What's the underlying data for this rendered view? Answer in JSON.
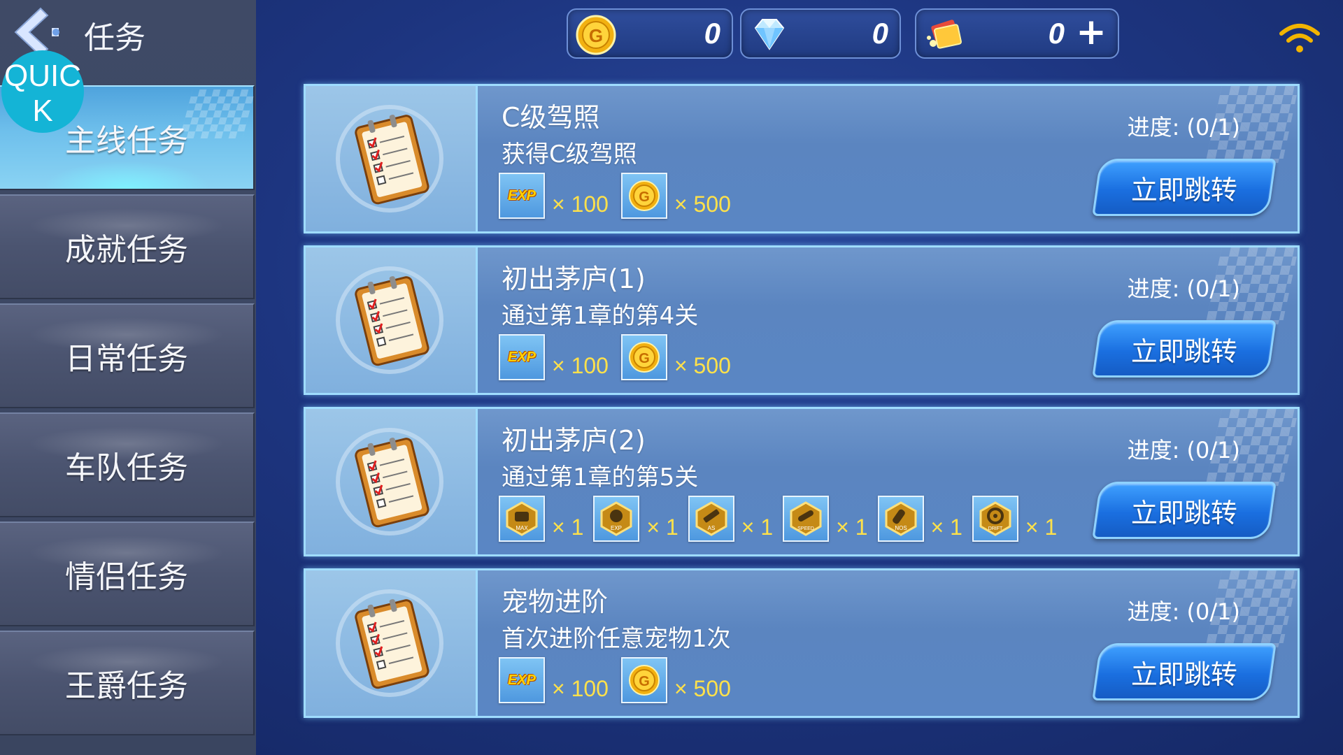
{
  "header": {
    "title": "任务",
    "quick_badge": "QUIC\nK"
  },
  "sidebar": {
    "tabs": [
      {
        "label": "主线任务",
        "active": true
      },
      {
        "label": "成就任务",
        "active": false
      },
      {
        "label": "日常任务",
        "active": false
      },
      {
        "label": "车队任务",
        "active": false
      },
      {
        "label": "情侣任务",
        "active": false
      },
      {
        "label": "王爵任务",
        "active": false
      }
    ]
  },
  "currency": {
    "coins": "0",
    "diamonds": "0",
    "tickets": "0",
    "plus_label": "+"
  },
  "tasks": [
    {
      "title": "C级驾照",
      "desc": "获得C级驾照",
      "progress": "进度: (0/1)",
      "button": "立即跳转",
      "rewards": [
        {
          "type": "exp",
          "label": "EXP",
          "qty": "× 100"
        },
        {
          "type": "coin",
          "label": "G",
          "qty": "× 500"
        }
      ]
    },
    {
      "title": "初出茅庐(1)",
      "desc": "通过第1章的第4关",
      "progress": "进度: (0/1)",
      "button": "立即跳转",
      "rewards": [
        {
          "type": "exp",
          "label": "EXP",
          "qty": "× 100"
        },
        {
          "type": "coin",
          "label": "G",
          "qty": "× 500"
        }
      ]
    },
    {
      "title": "初出茅庐(2)",
      "desc": "通过第1章的第5关",
      "progress": "进度: (0/1)",
      "button": "立即跳转",
      "rewards": [
        {
          "type": "part",
          "label": "MAX",
          "qty": "× 1"
        },
        {
          "type": "part",
          "label": "EXP",
          "qty": "× 1"
        },
        {
          "type": "part",
          "label": "AS",
          "qty": "× 1"
        },
        {
          "type": "part",
          "label": "SPEED",
          "qty": "× 1"
        },
        {
          "type": "part",
          "label": "NOS",
          "qty": "× 1"
        },
        {
          "type": "part",
          "label": "DRIFT",
          "qty": "× 1"
        }
      ]
    },
    {
      "title": "宠物进阶",
      "desc": "首次进阶任意宠物1次",
      "progress": "进度: (0/1)",
      "button": "立即跳转",
      "rewards": [
        {
          "type": "exp",
          "label": "EXP",
          "qty": "× 100"
        },
        {
          "type": "coin",
          "label": "G",
          "qty": "× 500"
        }
      ]
    }
  ],
  "colors": {
    "accent": "#1a6fe0",
    "reward_qty": "#ffe14a",
    "quick_badge": "#14b4d6"
  }
}
